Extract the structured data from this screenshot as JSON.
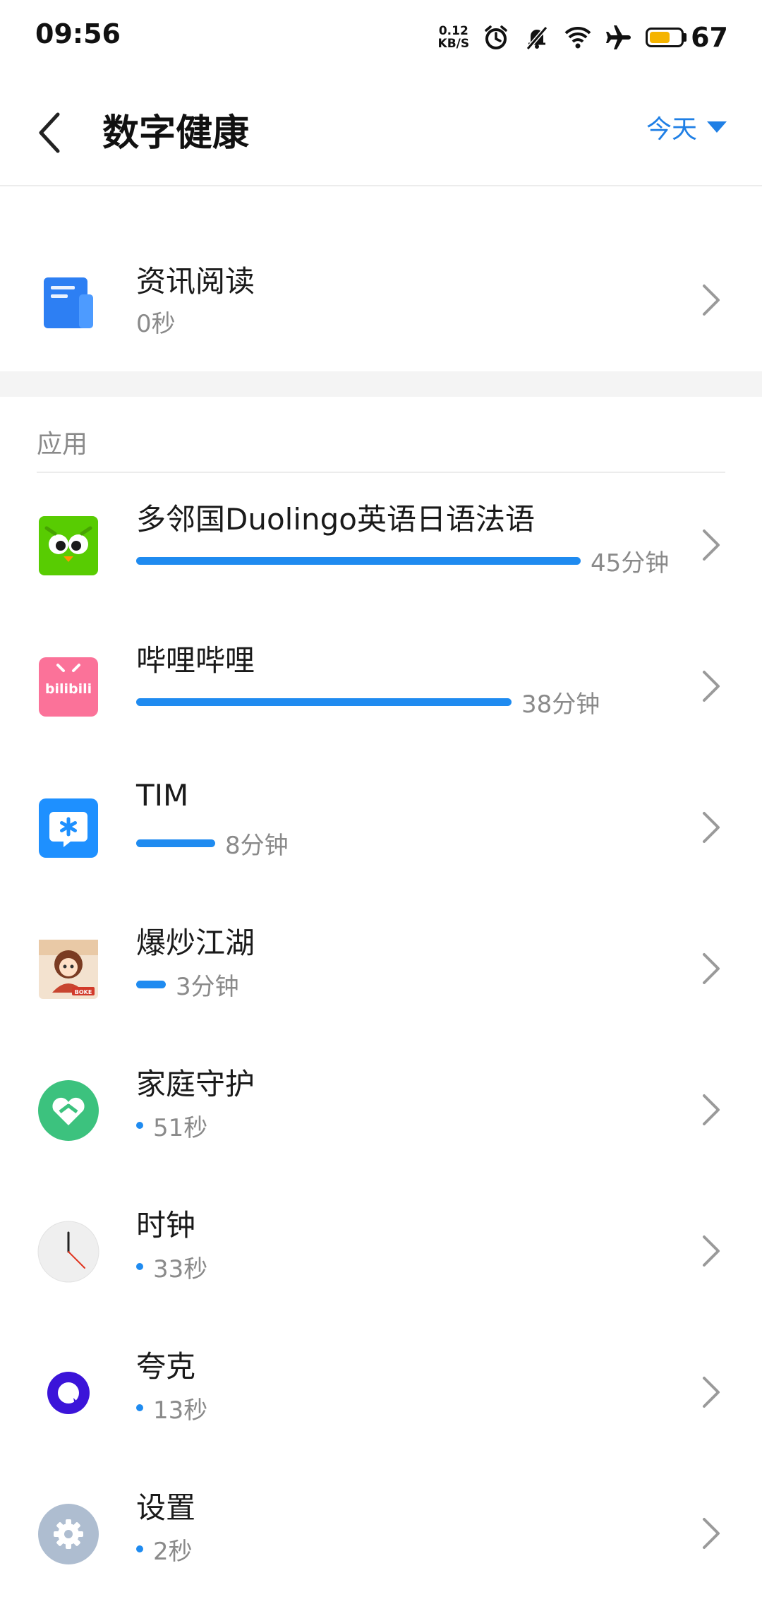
{
  "status_bar": {
    "time": "09:56",
    "net_speed_value": "0.12",
    "net_speed_unit": "KB/S",
    "battery": "67",
    "battery_level": 0.67
  },
  "header": {
    "title": "数字健康",
    "range_label": "今天"
  },
  "news_row": {
    "name": "资讯阅读",
    "time": "0秒"
  },
  "section": {
    "title": "应用"
  },
  "apps": [
    {
      "name": "多邻国Duolingo英语日语法语",
      "time": "45分钟",
      "minutes": 45,
      "icon": "duolingo-icon"
    },
    {
      "name": "哔哩哔哩",
      "time": "38分钟",
      "minutes": 38,
      "icon": "bilibili-icon",
      "icon_text": "bilibili"
    },
    {
      "name": "TIM",
      "time": "8分钟",
      "minutes": 8,
      "icon": "tim-icon"
    },
    {
      "name": "爆炒江湖",
      "time": "3分钟",
      "minutes": 3,
      "icon": "baochao-jianghu-icon",
      "icon_text": "BOKE"
    },
    {
      "name": "家庭守护",
      "time": "51秒",
      "minutes": 0.85,
      "icon": "family-guard-icon"
    },
    {
      "name": "时钟",
      "time": "33秒",
      "minutes": 0.55,
      "icon": "clock-icon"
    },
    {
      "name": "夸克",
      "time": "13秒",
      "minutes": 0.22,
      "icon": "quark-icon"
    },
    {
      "name": "设置",
      "time": "2秒",
      "minutes": 0.03,
      "icon": "settings-icon"
    }
  ],
  "colors": {
    "accent": "#1f7fe5",
    "bar": "#1f8bf0",
    "secondary_text": "#8a8a8a"
  }
}
